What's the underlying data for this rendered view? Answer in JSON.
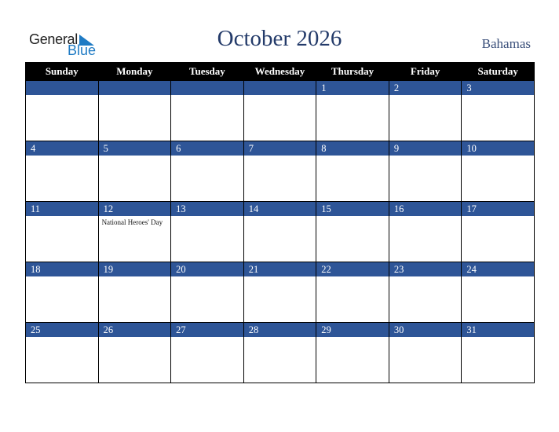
{
  "logo": {
    "general": "General",
    "blue": "Blue",
    "icon": "triangle-flag-icon"
  },
  "header": {
    "title": "October 2026",
    "country": "Bahamas"
  },
  "colors": {
    "header_bg": "#000000",
    "date_bar": "#2e5597",
    "title": "#243b6a"
  },
  "weekdays": [
    "Sunday",
    "Monday",
    "Tuesday",
    "Wednesday",
    "Thursday",
    "Friday",
    "Saturday"
  ],
  "weeks": [
    [
      {
        "d": ""
      },
      {
        "d": ""
      },
      {
        "d": ""
      },
      {
        "d": ""
      },
      {
        "d": "1"
      },
      {
        "d": "2"
      },
      {
        "d": "3"
      }
    ],
    [
      {
        "d": "4"
      },
      {
        "d": "5"
      },
      {
        "d": "6"
      },
      {
        "d": "7"
      },
      {
        "d": "8"
      },
      {
        "d": "9"
      },
      {
        "d": "10"
      }
    ],
    [
      {
        "d": "11"
      },
      {
        "d": "12",
        "e": "National Heroes' Day"
      },
      {
        "d": "13"
      },
      {
        "d": "14"
      },
      {
        "d": "15"
      },
      {
        "d": "16"
      },
      {
        "d": "17"
      }
    ],
    [
      {
        "d": "18"
      },
      {
        "d": "19"
      },
      {
        "d": "20"
      },
      {
        "d": "21"
      },
      {
        "d": "22"
      },
      {
        "d": "23"
      },
      {
        "d": "24"
      }
    ],
    [
      {
        "d": "25"
      },
      {
        "d": "26"
      },
      {
        "d": "27"
      },
      {
        "d": "28"
      },
      {
        "d": "29"
      },
      {
        "d": "30"
      },
      {
        "d": "31"
      }
    ]
  ]
}
